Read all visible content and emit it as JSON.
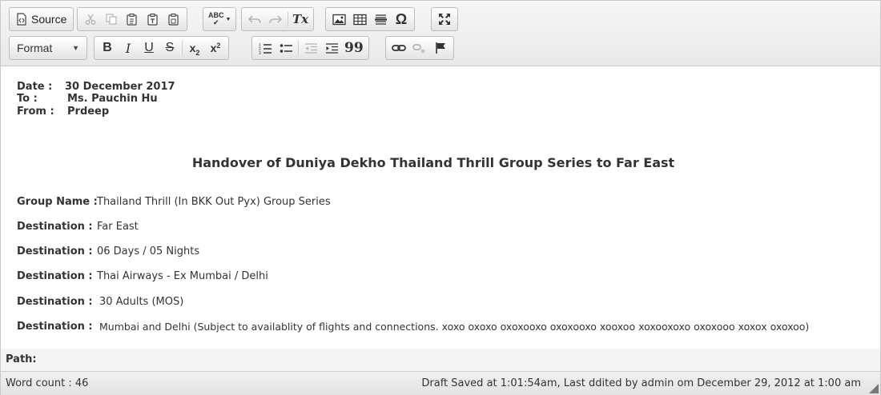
{
  "toolbar": {
    "source_label": "Source",
    "format_label": "Format",
    "spell_label": "ABC",
    "bold": "B",
    "italic": "I",
    "underline": "U",
    "strike": "S",
    "subscript_base": "x",
    "subscript_mark": "2",
    "superscript_base": "x",
    "superscript_mark": "2",
    "remove_format": "Tx",
    "special_char": "Ω",
    "blockquote": "99"
  },
  "header": {
    "date_label": "Date   :",
    "date_value": "30 December 2017",
    "to_label": "To      :",
    "to_value": "Ms. Pauchin Hu",
    "from_label": "From  :",
    "from_value": "Prdeep"
  },
  "title": "Handover of Duniya Dekho Thailand Thrill Group Series to Far East",
  "rows": [
    {
      "label": "Group Name :",
      "value": "Thailand Thrill (In BKK Out Pyx) Group Series"
    },
    {
      "label": "Destination   :",
      "value": "Far East"
    },
    {
      "label": "Destination   :",
      "value": "06 Days / 05 Nights"
    },
    {
      "label": "Destination   :",
      "value": "Thai Airways - Ex Mumbai / Delhi"
    },
    {
      "label": "Destination   :",
      "value": "30 Adults (MOS)"
    },
    {
      "label": "Destination   :",
      "value": "Mumbai and Delhi (Subject to availablity of flights and connections. xoxo oxoxo oxoxooxo oxoxooxo xooxoo xoxooxoxo oxoxooo xoxox oxoxoo)"
    }
  ],
  "path_label": "Path:",
  "status": {
    "word_count": "Word count : 46",
    "draft": "Draft Saved at 1:01:54am, Last ddited by admin om December 29, 2012 at 1:00 am"
  }
}
